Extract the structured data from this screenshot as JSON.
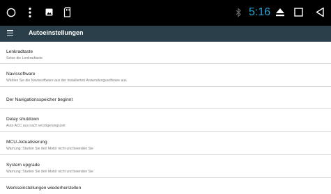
{
  "status_bar": {
    "time": "5:16",
    "icons": [
      "circle-icon",
      "more-vert-icon",
      "image-icon",
      "sd-card-icon",
      "bluetooth-icon",
      "eject-icon",
      "square-icon",
      "back-icon"
    ],
    "time_color": "#29a8d9"
  },
  "app_bar": {
    "title": "Autoeinstellungen",
    "menu_icon": "menu-icon",
    "color": "#2b3f4a"
  },
  "settings": [
    {
      "title": "Lenkradtaste",
      "subtitle": "Setze die Lenkradtaste"
    },
    {
      "title": "Navissoftware",
      "subtitle": "Wählen Sie die Navissoftware aus der installierten Anwendungssoftware aus"
    },
    {
      "title": "Der Navigationsspeicher beginnt",
      "subtitle": ""
    },
    {
      "title": "Delay shutdown",
      "subtitle": "Auto ACC aus nach verzögerungszeit"
    },
    {
      "title": "MCU-Aktualisierung",
      "subtitle": "Warnung: Starten Sie den Motor nicht und beenden Sie"
    },
    {
      "title": "System upgrade",
      "subtitle": "Warnung: Starten Sie den Motor nicht und beenden Sie"
    },
    {
      "title": "Werkseinstellungen wiederherstellen",
      "subtitle": ""
    }
  ]
}
